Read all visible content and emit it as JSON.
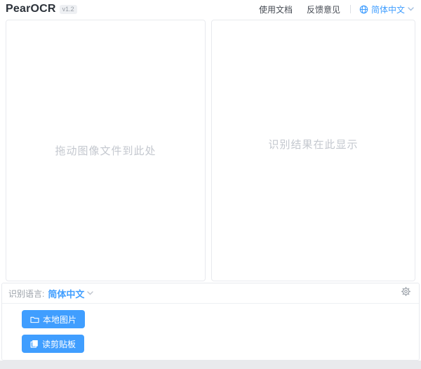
{
  "colors": {
    "accent": "#409eff",
    "placeholder_text": "#c4c8cf",
    "header_text": "#474c54",
    "muted_text": "#9aa0a8"
  },
  "header": {
    "logo": "PearOCR",
    "version_badge": "v1.2",
    "links": [
      {
        "label": "使用文档"
      },
      {
        "label": "反馈意见"
      }
    ],
    "language_selector": {
      "value": "简体中文"
    }
  },
  "panels": {
    "drop_zone_placeholder": "拖动图像文件到此处",
    "result_placeholder": "识别结果在此显示"
  },
  "bottom": {
    "language_label": "识别语言:",
    "language_value": "简体中文",
    "buttons": [
      {
        "label": "本地图片",
        "icon": "folder-icon"
      },
      {
        "label": "读剪贴板",
        "icon": "clipboard-icon"
      }
    ]
  }
}
